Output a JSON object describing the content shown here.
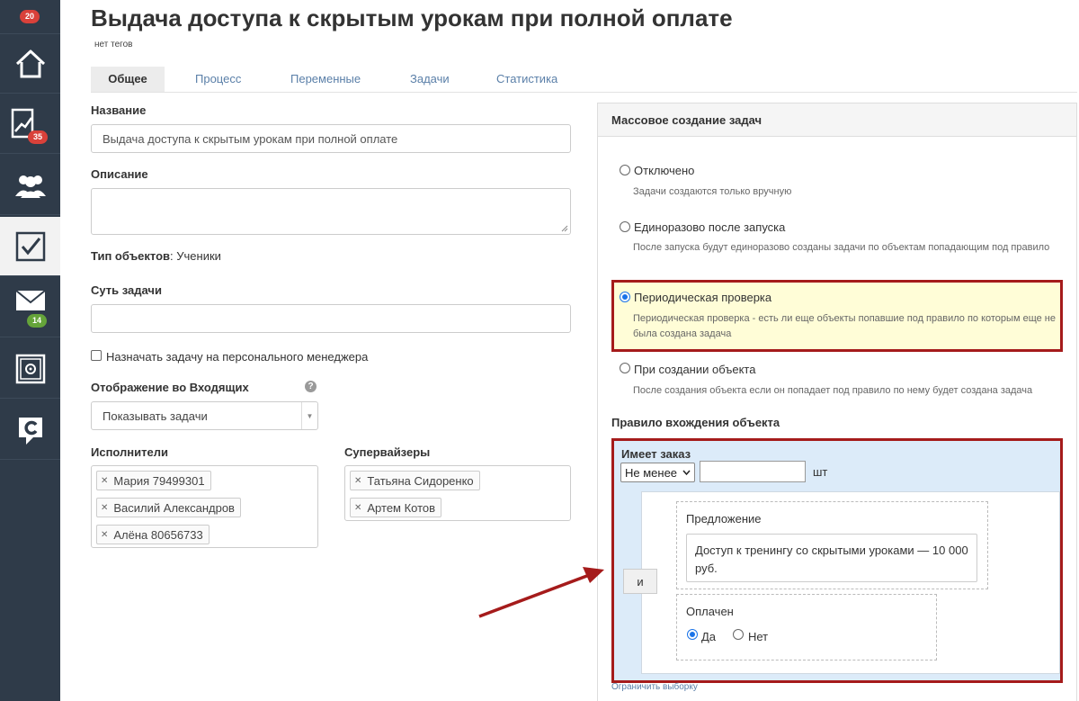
{
  "sidebar": {
    "items": [
      {
        "name": "notifications",
        "badge": "20"
      },
      {
        "name": "home-icon"
      },
      {
        "name": "sales-icon",
        "badge": "35"
      },
      {
        "name": "users-icon"
      },
      {
        "name": "tasks-icon",
        "active": true
      },
      {
        "name": "mail-icon",
        "badge": "14"
      },
      {
        "name": "safe-icon"
      },
      {
        "name": "logo-icon"
      }
    ]
  },
  "header": {
    "title": "Выдача доступа к скрытым урокам при полной оплате",
    "tags": "нет тегов"
  },
  "tabs": [
    "Общее",
    "Процесс",
    "Переменные",
    "Задачи",
    "Статистика"
  ],
  "form": {
    "name_label": "Название",
    "name_value": "Выдача доступа к скрытым урокам при полной оплате",
    "desc_label": "Описание",
    "object_type_label": "Тип объектов",
    "object_type_value": ": Ученики",
    "essence_label": "Суть задачи",
    "assign_manager_label": "Назначать задачу на персонального менеджера",
    "inbox_label": "Отображение во Входящих",
    "inbox_value": "Показывать задачи",
    "executors_label": "Исполнители",
    "executors": [
      "Мария 79499301",
      "Василий Александров",
      "Алёна 80656733"
    ],
    "supervisors_label": "Супервайзеры",
    "supervisors": [
      "Татьяна Сидоренко",
      "Артем Котов"
    ]
  },
  "mass_create": {
    "title": "Массовое создание задач",
    "options": [
      {
        "label": "Отключено",
        "desc": "Задачи создаются только вручную",
        "selected": false
      },
      {
        "label": "Единоразово после запуска",
        "desc": "После запуска будут единоразово созданы задачи по объектам попадающим под правило",
        "selected": false
      },
      {
        "label": "Периодическая проверка",
        "desc": "Периодическая проверка - есть ли еще объекты попавшие под правило по которым еще не была создана задача",
        "selected": true
      },
      {
        "label": "При создании объекта",
        "desc": "После создания объекта если он попадает под правило по нему будет создана задача",
        "selected": false
      }
    ]
  },
  "rule": {
    "title": "Правило вхождения объекта",
    "has_order": "Имеет заказ",
    "compare_value": "Не менее",
    "unit": "шт",
    "and_label": "и",
    "offer_label": "Предложение",
    "offer_value": "Доступ к тренингу со скрытыми уроками — 10 000 руб.",
    "paid_label": "Оплачен",
    "yes_label": "Да",
    "no_label": "Нет",
    "paid_selected": "Да",
    "limit_link": "Ограничить выборку"
  },
  "colors": {
    "sidebar": "#2f3b49",
    "highlight_border": "#a51b1b",
    "highlight_bg": "#fffdd7",
    "rule_bg": "#dcebf9",
    "tab_link": "#5a7fa8"
  }
}
